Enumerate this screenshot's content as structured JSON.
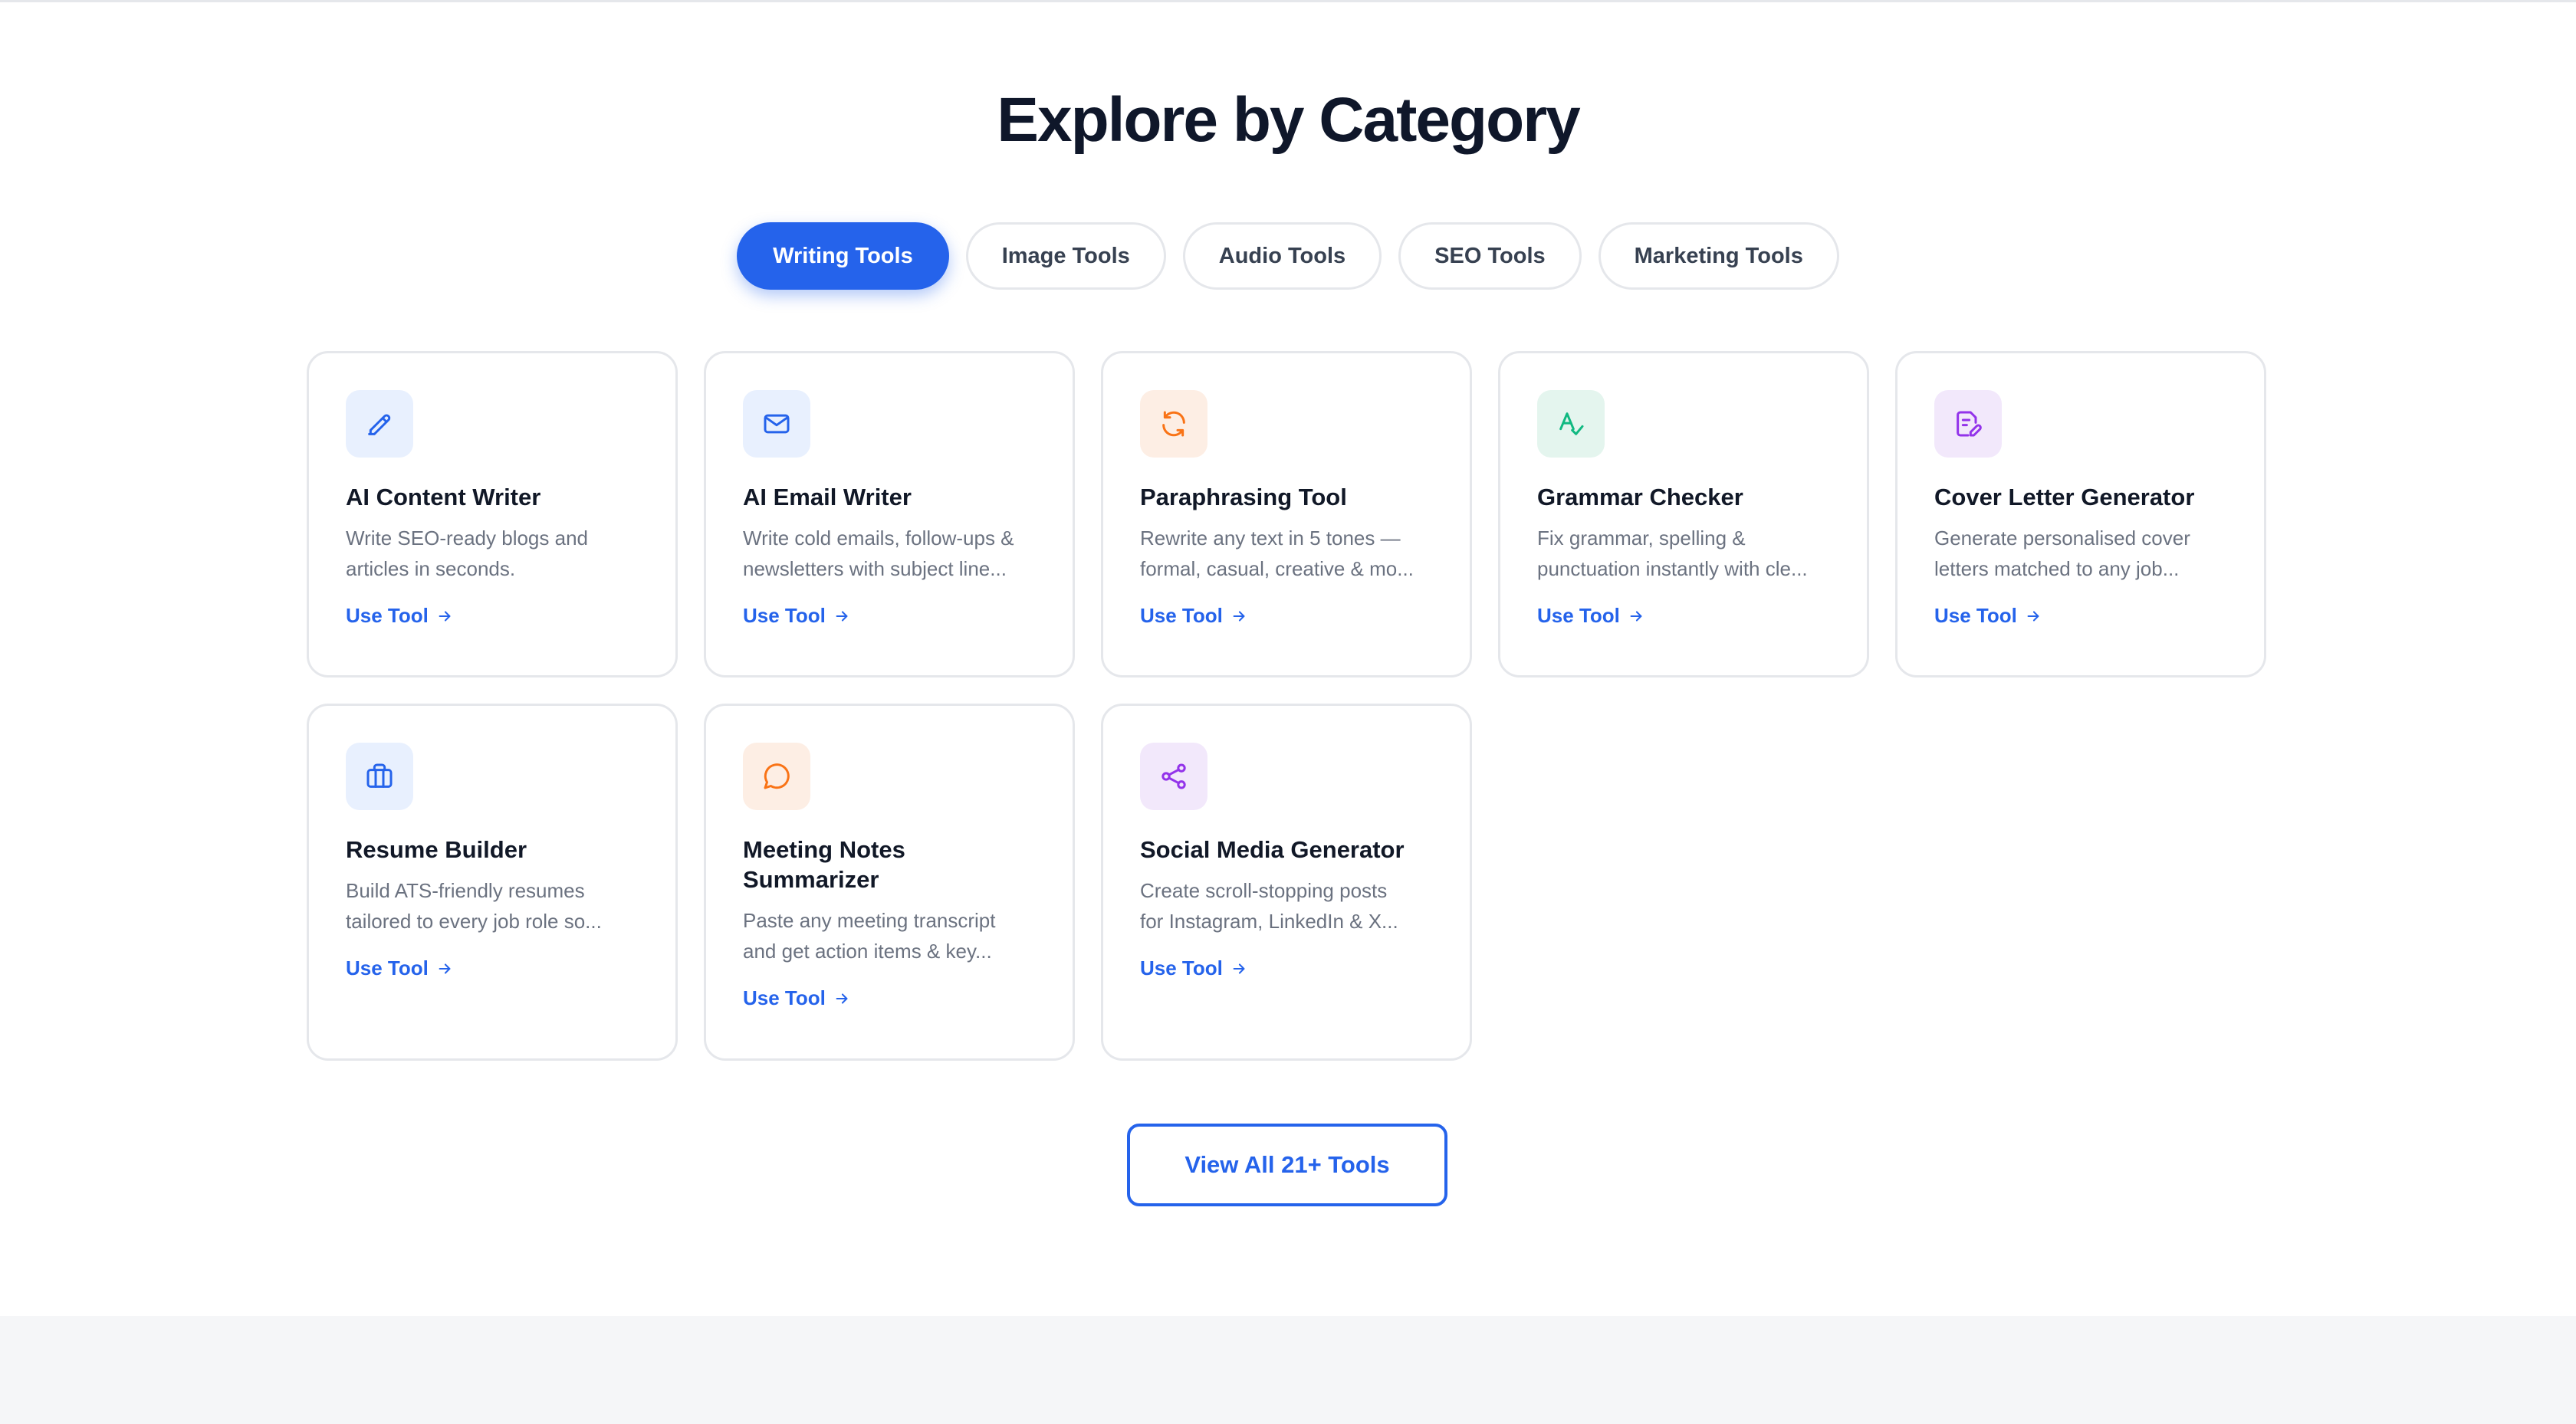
{
  "heading": "Explore by Category",
  "tabs": [
    {
      "label": "Writing Tools",
      "active": true
    },
    {
      "label": "Image Tools",
      "active": false
    },
    {
      "label": "Audio Tools",
      "active": false
    },
    {
      "label": "SEO Tools",
      "active": false
    },
    {
      "label": "Marketing Tools",
      "active": false
    }
  ],
  "cards": [
    {
      "title": "AI Content Writer",
      "desc_line1": "Write SEO-ready blogs and",
      "desc_line2": "articles in seconds.",
      "link": "Use Tool",
      "icon": "pencil-icon",
      "color": "#2563eb"
    },
    {
      "title": "AI Email Writer",
      "desc_line1": "Write cold emails, follow-ups &",
      "desc_line2": "newsletters with subject line...",
      "link": "Use Tool",
      "icon": "mail-icon",
      "color": "#2563eb"
    },
    {
      "title": "Paraphrasing Tool",
      "desc_line1": "Rewrite any text in 5 tones —",
      "desc_line2": "formal, casual, creative & mo...",
      "link": "Use Tool",
      "icon": "refresh-icon",
      "color": "#f97316"
    },
    {
      "title": "Grammar Checker",
      "desc_line1": "Fix grammar, spelling &",
      "desc_line2": "punctuation instantly with cle...",
      "link": "Use Tool",
      "icon": "spell-check-icon",
      "color": "#10b981"
    },
    {
      "title": "Cover Letter Generator",
      "desc_line1": "Generate personalised cover",
      "desc_line2": "letters matched to any job...",
      "link": "Use Tool",
      "icon": "document-edit-icon",
      "color": "#9333ea"
    },
    {
      "title": "Resume Builder",
      "desc_line1": "Build ATS-friendly resumes",
      "desc_line2": "tailored to every job role so...",
      "link": "Use Tool",
      "icon": "briefcase-icon",
      "color": "#2563eb"
    },
    {
      "title_line1": "Meeting Notes",
      "title_line2": "Summarizer",
      "desc_line1": "Paste any meeting transcript",
      "desc_line2": "and get action items & key...",
      "link": "Use Tool",
      "icon": "chat-bubble-icon",
      "color": "#f97316"
    },
    {
      "title": "Social Media Generator",
      "desc_line1": "Create scroll-stopping posts",
      "desc_line2": "for Instagram, LinkedIn & X...",
      "link": "Use Tool",
      "icon": "share-icon",
      "color": "#9333ea"
    }
  ],
  "view_all_label": "View All 21+ Tools",
  "colors": {
    "accent": "#2563eb",
    "heading": "#0f172a",
    "muted": "#6b7280"
  }
}
